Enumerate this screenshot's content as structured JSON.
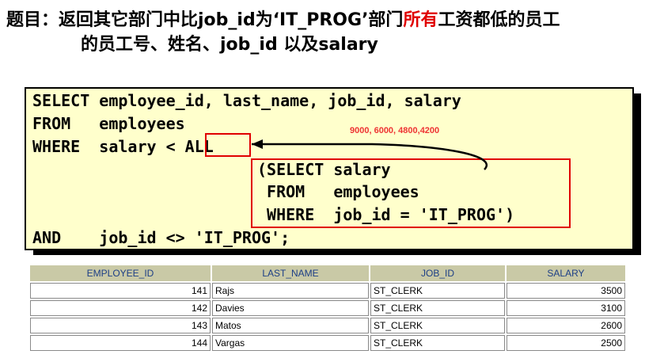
{
  "title": {
    "prefix": "题目：返回其它部门中比job_id为‘IT_PROG’部门",
    "highlight": "所有",
    "suffix": "工资都低的员工",
    "line2": "的员工号、姓名、job_id 以及salary"
  },
  "sql": {
    "line1": "SELECT employee_id, last_name, job_id, salary",
    "line2": "FROM   employees",
    "line3_prefix": "WHERE  salary < ",
    "line3_keyword": "ALL",
    "sub1": "(SELECT salary",
    "sub2": " FROM   employees",
    "sub3": " WHERE  job_id = 'IT_PROG')",
    "line_and": "AND    job_id <> 'IT_PROG';"
  },
  "annotation": "9000, 6000, 4800,4200",
  "colors": {
    "highlight": "#e00000",
    "code_bg": "#ffffcc",
    "header_bg": "#c9c9a6",
    "header_text": "#1d3f86"
  },
  "table": {
    "headers": [
      "EMPLOYEE_ID",
      "LAST_NAME",
      "JOB_ID",
      "SALARY"
    ],
    "rows": [
      [
        "141",
        "Rajs",
        "ST_CLERK",
        "3500"
      ],
      [
        "142",
        "Davies",
        "ST_CLERK",
        "3100"
      ],
      [
        "143",
        "Matos",
        "ST_CLERK",
        "2600"
      ],
      [
        "144",
        "Vargas",
        "ST_CLERK",
        "2500"
      ]
    ]
  }
}
